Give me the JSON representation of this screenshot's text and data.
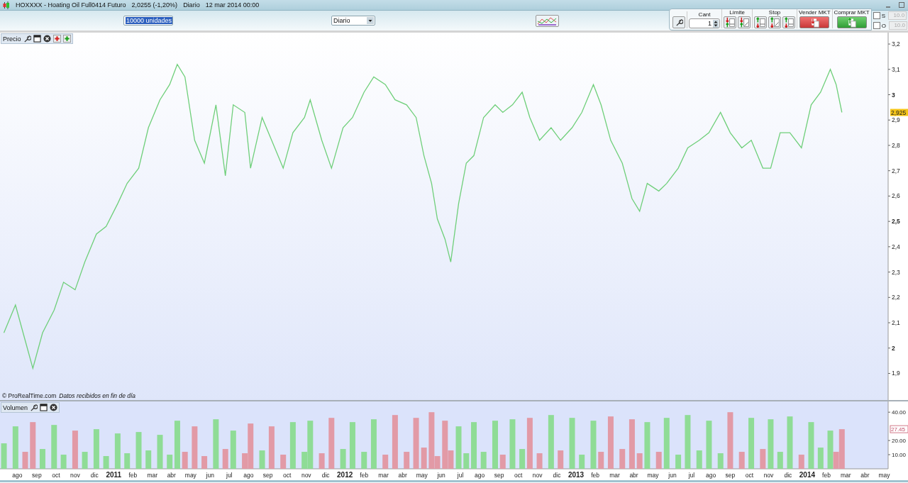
{
  "window": {
    "symbol": "HOXXXX - Hoating Oil Full0414 Futuro",
    "quote": "2,0255 (-1,20%)",
    "period": "Diario",
    "datetime": "12 mar 2014 00:00"
  },
  "toolbar": {
    "quantity_dropdown": {
      "value": "10000 unidades"
    },
    "period_dropdown": {
      "value": "Diario"
    }
  },
  "order_panel": {
    "quantity": {
      "label": "Cant",
      "value": "1"
    },
    "limit": {
      "label": "Límite"
    },
    "stop": {
      "label": "Stop"
    },
    "sell": {
      "label": "Vender MKT"
    },
    "buy": {
      "label": "Comprar MKT"
    },
    "options": [
      {
        "label": "S",
        "checked": false,
        "value": "10.0",
        "disabled": true
      },
      {
        "label": "O",
        "checked": false,
        "value": "10.0",
        "disabled": true
      }
    ]
  },
  "price_panel": {
    "last_price": "2,925",
    "credit": "© ProRealTime.com",
    "note": "Datos recibidos en fin de día",
    "chart_data": {
      "type": "line",
      "xlim": [
        2010.508,
        2014.436
      ],
      "ylim": [
        1.795,
        3.245
      ],
      "x": [
        2010.525,
        2010.575,
        2010.617,
        2010.65,
        2010.692,
        2010.742,
        2010.783,
        2010.833,
        2010.875,
        2010.925,
        2010.967,
        2011.017,
        2011.058,
        2011.108,
        2011.15,
        2011.2,
        2011.242,
        2011.275,
        2011.308,
        2011.35,
        2011.392,
        2011.442,
        2011.483,
        2011.517,
        2011.567,
        2011.592,
        2011.642,
        2011.683,
        2011.733,
        2011.775,
        2011.825,
        2011.85,
        2011.9,
        2011.942,
        2011.992,
        2012.033,
        2012.083,
        2012.125,
        2012.175,
        2012.217,
        2012.267,
        2012.308,
        2012.342,
        2012.375,
        2012.4,
        2012.433,
        2012.458,
        2012.492,
        2012.525,
        2012.558,
        2012.6,
        2012.65,
        2012.683,
        2012.725,
        2012.767,
        2012.8,
        2012.842,
        2012.892,
        2012.933,
        2012.983,
        2013.025,
        2013.075,
        2013.108,
        2013.15,
        2013.2,
        2013.242,
        2013.275,
        2013.308,
        2013.358,
        2013.392,
        2013.442,
        2013.483,
        2013.533,
        2013.575,
        2013.625,
        2013.667,
        2013.717,
        2013.758,
        2013.808,
        2013.842,
        2013.883,
        2013.925,
        2013.975,
        2014.017,
        2014.058,
        2014.1,
        2014.125,
        2014.15
      ],
      "series": [
        {
          "name": "Precio",
          "color": "#6fcf7a",
          "values": [
            2.06,
            2.17,
            2.03,
            1.92,
            2.06,
            2.15,
            2.26,
            2.23,
            2.34,
            2.45,
            2.48,
            2.57,
            2.65,
            2.71,
            2.87,
            2.98,
            3.04,
            3.12,
            3.07,
            2.82,
            2.73,
            2.96,
            2.68,
            2.96,
            2.93,
            2.71,
            2.91,
            2.82,
            2.71,
            2.85,
            2.91,
            2.98,
            2.82,
            2.71,
            2.87,
            2.91,
            3.01,
            3.07,
            3.04,
            2.98,
            2.96,
            2.91,
            2.76,
            2.65,
            2.51,
            2.43,
            2.34,
            2.57,
            2.73,
            2.76,
            2.91,
            2.96,
            2.93,
            2.96,
            3.01,
            2.91,
            2.82,
            2.87,
            2.82,
            2.87,
            2.93,
            3.04,
            2.96,
            2.82,
            2.73,
            2.59,
            2.54,
            2.65,
            2.62,
            2.65,
            2.71,
            2.79,
            2.82,
            2.85,
            2.93,
            2.85,
            2.79,
            2.82,
            2.71,
            2.71,
            2.85,
            2.85,
            2.79,
            2.96,
            3.01,
            3.1,
            3.04,
            2.93
          ]
        }
      ],
      "yticks": [
        {
          "value": 3.2,
          "label": "3,2"
        },
        {
          "value": 3.1,
          "label": "3,1"
        },
        {
          "value": 3.0,
          "label": "3"
        },
        {
          "value": 2.9,
          "label": "2,9"
        },
        {
          "value": 2.8,
          "label": "2,8"
        },
        {
          "value": 2.7,
          "label": "2,7"
        },
        {
          "value": 2.6,
          "label": "2,6"
        },
        {
          "value": 2.5,
          "label": "2,5"
        },
        {
          "value": 2.4,
          "label": "2,4"
        },
        {
          "value": 2.3,
          "label": "2,3"
        },
        {
          "value": 2.2,
          "label": "2,2"
        },
        {
          "value": 2.1,
          "label": "2,1"
        },
        {
          "value": 2.0,
          "label": "2"
        },
        {
          "value": 1.9,
          "label": "1,9"
        }
      ]
    }
  },
  "volume_panel": {
    "last_value": "27.45",
    "chart_data": {
      "type": "bar",
      "xlim": [
        2010.508,
        2014.436
      ],
      "ylim": [
        0,
        47.6
      ],
      "x": [
        2010.525,
        2010.575,
        2010.617,
        2010.65,
        2010.692,
        2010.742,
        2010.783,
        2010.833,
        2010.875,
        2010.925,
        2010.967,
        2011.017,
        2011.058,
        2011.108,
        2011.15,
        2011.2,
        2011.242,
        2011.275,
        2011.308,
        2011.35,
        2011.392,
        2011.442,
        2011.483,
        2011.517,
        2011.567,
        2011.592,
        2011.642,
        2011.683,
        2011.733,
        2011.775,
        2011.825,
        2011.85,
        2011.9,
        2011.942,
        2011.992,
        2012.033,
        2012.083,
        2012.125,
        2012.175,
        2012.217,
        2012.267,
        2012.308,
        2012.342,
        2012.375,
        2012.4,
        2012.433,
        2012.458,
        2012.492,
        2012.525,
        2012.558,
        2012.6,
        2012.65,
        2012.683,
        2012.725,
        2012.767,
        2012.8,
        2012.842,
        2012.892,
        2012.933,
        2012.983,
        2013.025,
        2013.075,
        2013.108,
        2013.15,
        2013.2,
        2013.242,
        2013.275,
        2013.308,
        2013.358,
        2013.392,
        2013.442,
        2013.483,
        2013.533,
        2013.575,
        2013.625,
        2013.667,
        2013.717,
        2013.758,
        2013.808,
        2013.842,
        2013.883,
        2013.925,
        2013.975,
        2014.017,
        2014.058,
        2014.1,
        2014.125,
        2014.15
      ],
      "series": [
        {
          "name": "Volumen",
          "values": [
            18,
            30,
            12,
            33,
            14,
            31,
            10,
            27,
            12,
            28,
            9,
            25,
            11,
            26,
            13,
            24,
            10,
            34,
            12,
            30,
            9,
            35,
            14,
            27,
            11,
            32,
            13,
            30,
            10,
            33,
            12,
            34,
            11,
            36,
            14,
            33,
            12,
            35,
            10,
            38,
            12,
            36,
            15,
            40,
            9,
            34,
            13,
            30,
            11,
            33,
            12,
            34,
            10,
            35,
            14,
            36,
            11,
            38,
            13,
            36,
            10,
            34,
            12,
            37,
            14,
            35,
            11,
            33,
            12,
            36,
            10,
            38,
            13,
            34,
            11,
            40,
            12,
            36,
            14,
            35,
            12,
            37,
            10,
            33,
            15,
            27,
            12,
            28
          ]
        }
      ],
      "yticks": [
        {
          "value": 10,
          "label": "10.00"
        },
        {
          "value": 20,
          "label": "20.00"
        },
        {
          "value": 40,
          "label": "40.00"
        }
      ],
      "xticks": [
        {
          "value": 2010.583,
          "label": "ago"
        },
        {
          "value": 2010.667,
          "label": "sep"
        },
        {
          "value": 2010.75,
          "label": "oct"
        },
        {
          "value": 2010.833,
          "label": "nov"
        },
        {
          "value": 2010.917,
          "label": "dic"
        },
        {
          "value": 2011,
          "label": "2011"
        },
        {
          "value": 2011.083,
          "label": "feb"
        },
        {
          "value": 2011.167,
          "label": "mar"
        },
        {
          "value": 2011.25,
          "label": "abr"
        },
        {
          "value": 2011.333,
          "label": "may"
        },
        {
          "value": 2011.417,
          "label": "jun"
        },
        {
          "value": 2011.5,
          "label": "jul"
        },
        {
          "value": 2011.583,
          "label": "ago"
        },
        {
          "value": 2011.667,
          "label": "sep"
        },
        {
          "value": 2011.75,
          "label": "oct"
        },
        {
          "value": 2011.833,
          "label": "nov"
        },
        {
          "value": 2011.917,
          "label": "dic"
        },
        {
          "value": 2012,
          "label": "2012"
        },
        {
          "value": 2012.083,
          "label": "feb"
        },
        {
          "value": 2012.167,
          "label": "mar"
        },
        {
          "value": 2012.25,
          "label": "abr"
        },
        {
          "value": 2012.333,
          "label": "may"
        },
        {
          "value": 2012.417,
          "label": "jun"
        },
        {
          "value": 2012.5,
          "label": "jul"
        },
        {
          "value": 2012.583,
          "label": "ago"
        },
        {
          "value": 2012.667,
          "label": "sep"
        },
        {
          "value": 2012.75,
          "label": "oct"
        },
        {
          "value": 2012.833,
          "label": "nov"
        },
        {
          "value": 2012.917,
          "label": "dic"
        },
        {
          "value": 2013,
          "label": "2013"
        },
        {
          "value": 2013.083,
          "label": "feb"
        },
        {
          "value": 2013.167,
          "label": "mar"
        },
        {
          "value": 2013.25,
          "label": "abr"
        },
        {
          "value": 2013.333,
          "label": "may"
        },
        {
          "value": 2013.417,
          "label": "jun"
        },
        {
          "value": 2013.5,
          "label": "jul"
        },
        {
          "value": 2013.583,
          "label": "ago"
        },
        {
          "value": 2013.667,
          "label": "sep"
        },
        {
          "value": 2013.75,
          "label": "oct"
        },
        {
          "value": 2013.833,
          "label": "nov"
        },
        {
          "value": 2013.917,
          "label": "dic"
        },
        {
          "value": 2014,
          "label": "2014"
        },
        {
          "value": 2014.083,
          "label": "feb"
        },
        {
          "value": 2014.167,
          "label": "mar"
        },
        {
          "value": 2014.25,
          "label": "abr"
        },
        {
          "value": 2014.333,
          "label": "may"
        }
      ]
    }
  }
}
